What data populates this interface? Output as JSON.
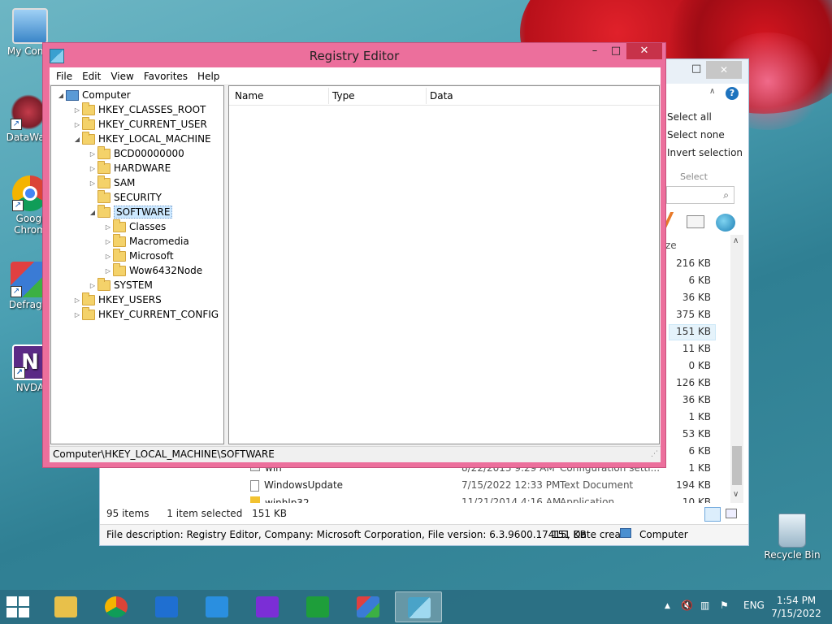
{
  "desktop": {
    "icons": [
      {
        "label": "My Comp",
        "icon": "computer-icon"
      },
      {
        "label": "DataWag",
        "icon": "datawag-icon"
      },
      {
        "label": "Googl Chrom",
        "icon": "chrome-icon"
      },
      {
        "label": "Defragg",
        "icon": "defraggler-icon"
      },
      {
        "label": "NVDA",
        "icon": "nvda-icon"
      },
      {
        "label": "Recycle Bin",
        "icon": "recycle-bin-icon"
      }
    ]
  },
  "explorer": {
    "ribbon": {
      "select_all": "Select all",
      "select_none": "Select none",
      "invert_selection": "Invert selection",
      "group_label": "Select"
    },
    "size_header_fragment": "ze",
    "sizes": [
      "216 KB",
      "6 KB",
      "36 KB",
      "375 KB",
      "151 KB",
      "11 KB",
      "0 KB",
      "126 KB",
      "36 KB",
      "1 KB",
      "53 KB",
      "6 KB",
      "1 KB",
      "194 KB",
      "10 KB"
    ],
    "rows": [
      {
        "name": "win",
        "date": "8/22/2013 9:29 AM",
        "type": "Configuration setti..."
      },
      {
        "name": "WindowsUpdate",
        "date": "7/15/2022 12:33 PM",
        "type": "Text Document"
      },
      {
        "name": "winhlp32",
        "date": "11/21/2014 4:16 AM",
        "type": "Application"
      }
    ],
    "status": {
      "items_count": "95 items",
      "selected": "1 item selected",
      "selected_size": "151 KB"
    },
    "info_bar": {
      "description": "File description: Registry Editor, Company: Microsoft Corporation, File version: 6.3.9600.17415, Date crea",
      "size": "151 KB",
      "location": "Computer"
    }
  },
  "regedit": {
    "title": "Registry Editor",
    "controls": {
      "minimize": "–",
      "maximize": "□",
      "close": "✕"
    },
    "menu": [
      "File",
      "Edit",
      "View",
      "Favorites",
      "Help"
    ],
    "tree": {
      "root": "Computer",
      "nodes": [
        {
          "label": "HKEY_CLASSES_ROOT",
          "level": 1,
          "expander": "▷"
        },
        {
          "label": "HKEY_CURRENT_USER",
          "level": 1,
          "expander": "▷"
        },
        {
          "label": "HKEY_LOCAL_MACHINE",
          "level": 1,
          "expander": "◢"
        },
        {
          "label": "BCD00000000",
          "level": 2,
          "expander": "▷"
        },
        {
          "label": "HARDWARE",
          "level": 2,
          "expander": "▷"
        },
        {
          "label": "SAM",
          "level": 2,
          "expander": "▷"
        },
        {
          "label": "SECURITY",
          "level": 2,
          "expander": ""
        },
        {
          "label": "SOFTWARE",
          "level": 2,
          "expander": "◢",
          "selected": true
        },
        {
          "label": "Classes",
          "level": 3,
          "expander": "▷"
        },
        {
          "label": "Macromedia",
          "level": 3,
          "expander": "▷"
        },
        {
          "label": "Microsoft",
          "level": 3,
          "expander": "▷"
        },
        {
          "label": "Wow6432Node",
          "level": 3,
          "expander": "▷"
        },
        {
          "label": "SYSTEM",
          "level": 2,
          "expander": "▷"
        },
        {
          "label": "HKEY_USERS",
          "level": 1,
          "expander": "▷"
        },
        {
          "label": "HKEY_CURRENT_CONFIG",
          "level": 1,
          "expander": "▷"
        }
      ]
    },
    "columns": [
      "Name",
      "Type",
      "Data"
    ],
    "status_path": "Computer\\HKEY_LOCAL_MACHINE\\SOFTWARE"
  },
  "taskbar": {
    "apps": [
      {
        "icon": "file-explorer-icon",
        "color": "#e8c04a"
      },
      {
        "icon": "chrome-icon",
        "color": "#db4437"
      },
      {
        "icon": "mail-icon",
        "color": "#1f6fd1"
      },
      {
        "icon": "weather-icon",
        "color": "#2a8fe0"
      },
      {
        "icon": "search-icon",
        "color": "#7b2ed6"
      },
      {
        "icon": "store-icon",
        "color": "#1e9e3a"
      },
      {
        "icon": "defraggler-icon",
        "color": "#3a7bd5"
      },
      {
        "icon": "regedit-icon",
        "color": "#49a3c8"
      }
    ],
    "language": "ENG",
    "time": "1:54 PM",
    "date": "7/15/2022"
  }
}
